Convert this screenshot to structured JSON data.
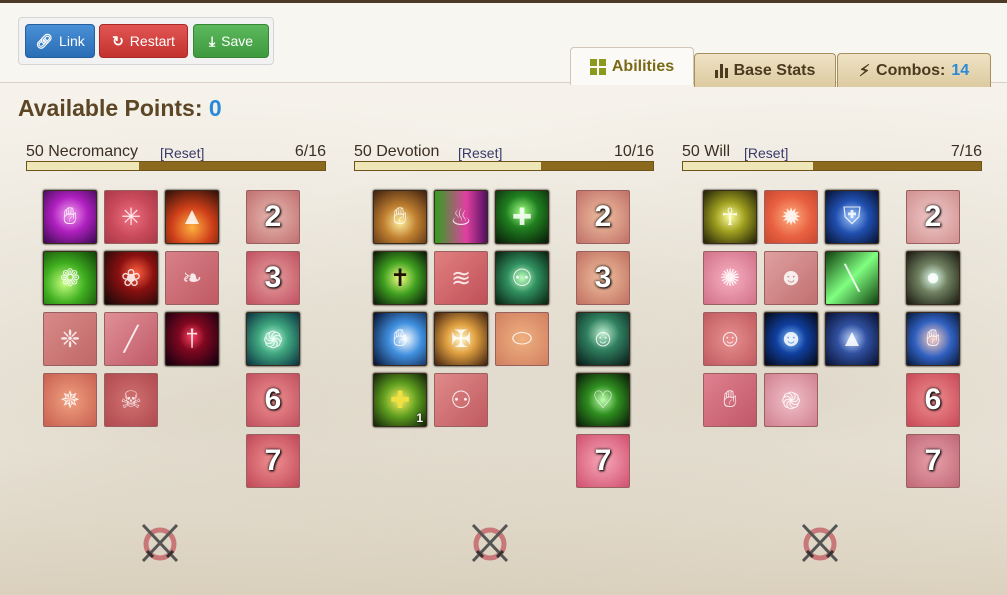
{
  "toolbar": {
    "link_label": "Link",
    "restart_label": "Restart",
    "save_label": "Save"
  },
  "tabs": {
    "abilities": "Abilities",
    "base_stats": "Base Stats",
    "combos_label": "Combos:",
    "combos_count": "14"
  },
  "available": {
    "label": "Available Points:",
    "value": "0"
  },
  "trees": [
    {
      "name": "50 Necromancy",
      "reset": "[Reset]",
      "count": "6/16",
      "fill": 0.375
    },
    {
      "name": "50 Devotion",
      "reset": "[Reset]",
      "count": "10/16",
      "fill": 0.625
    },
    {
      "name": "50 Will",
      "reset": "[Reset]",
      "count": "7/16",
      "fill": 0.4375
    }
  ],
  "tier_labels": [
    "2",
    "3",
    "6",
    "7"
  ],
  "icons": {
    "devotion_badge": "1"
  },
  "colors": {
    "link_button": "#337ab7",
    "restart_button": "#d9534f",
    "save_button": "#5cb85c",
    "points_value": "#2a8ad8",
    "tree_bar": "#8b6a1e"
  }
}
